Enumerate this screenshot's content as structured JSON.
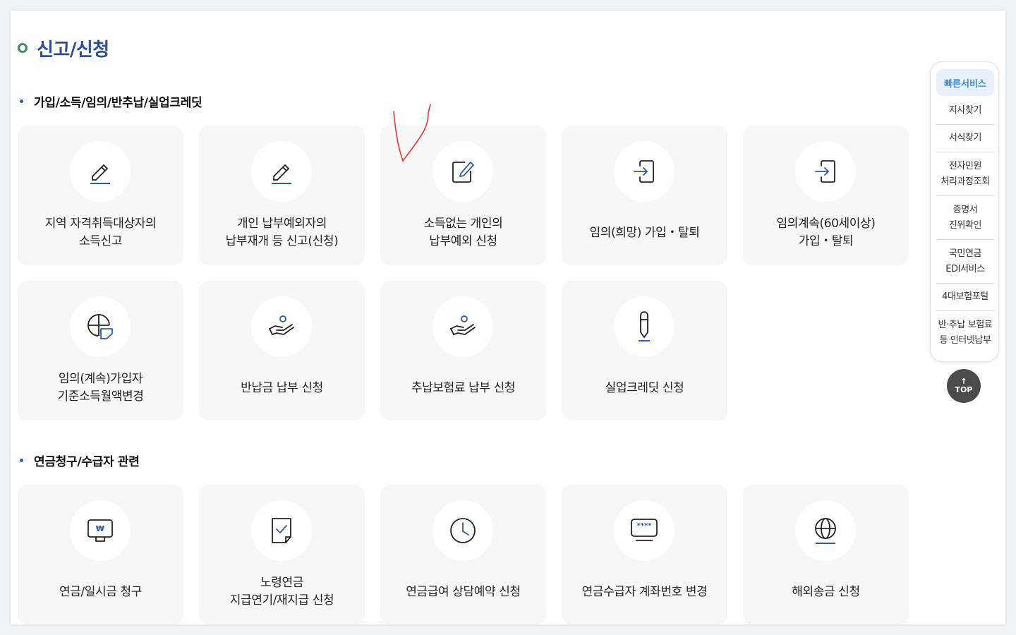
{
  "page_title": "신고/신청",
  "sections": [
    {
      "title": "가입/소득/임의/반추납/실업크레딧",
      "cards": [
        {
          "label": "지역 자격취득대상자의\n소득신고",
          "icon": "pencil-icon"
        },
        {
          "label": "개인 납부예외자의\n납부재개 등 신고(신청)",
          "icon": "pencil-icon"
        },
        {
          "label": "소득없는 개인의\n납부예외 신청",
          "icon": "edit-square-icon"
        },
        {
          "label": "임의(희망) 가입・탈퇴",
          "icon": "enter-icon"
        },
        {
          "label": "임의계속(60세이상)\n가입・탈퇴",
          "icon": "enter-icon"
        },
        {
          "label": "임의(계속)가입자\n기준소득월액변경",
          "icon": "globe-shield-icon"
        },
        {
          "label": "반납금 납부 신청",
          "icon": "hand-payment-icon"
        },
        {
          "label": "추납보험료 납부 신청",
          "icon": "hand-payment-icon"
        },
        {
          "label": "실업크레딧 신청",
          "icon": "pen-icon"
        }
      ]
    },
    {
      "title": "연금청구/수급자 관련",
      "cards": [
        {
          "label": "연금/일시금 청구",
          "icon": "monitor-won-icon"
        },
        {
          "label": "노령연금\n지급연기/재지급 신청",
          "icon": "document-check-icon"
        },
        {
          "label": "연금급여 상담예약 신청",
          "icon": "clock-icon"
        },
        {
          "label": "연금수급자 계좌번호 변경",
          "icon": "password-monitor-icon"
        },
        {
          "label": "해외송금 신청",
          "icon": "globe-icon"
        }
      ]
    }
  ],
  "icon_glyphs": {
    "won": "₩",
    "password": "****"
  },
  "quick_service": {
    "title": "빠른서비스",
    "items": [
      "지사찾기",
      "서식찾기",
      "전자민원\n처리과정조회",
      "증명서\n진위확인",
      "국민연금\nEDI서비스",
      "4대보험포털",
      "반·추납 보험료\n등 인터넷납부"
    ]
  },
  "top_button": {
    "arrow": "↑",
    "label": "TOP"
  },
  "colors": {
    "title": "#2d4f8f",
    "title_bullet": "#3f8e63",
    "accent_blue": "#3e8dd4",
    "icon_line": "#222222",
    "icon_accent": "#2d5aa0",
    "annotation": "#e53935"
  }
}
